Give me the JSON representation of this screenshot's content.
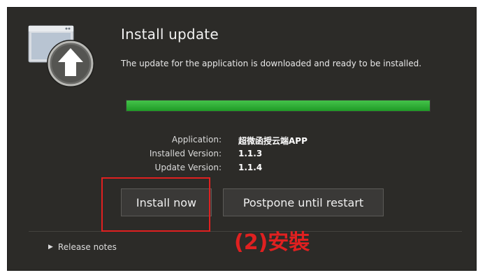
{
  "dialog": {
    "title": "Install update",
    "description": "The update for the application is downloaded and ready to be installed.",
    "progress": 1.0,
    "progress_color": "#2db334",
    "info": [
      {
        "label": "Application:",
        "value": "超微函授云端APP"
      },
      {
        "label": "Installed Version:",
        "value": "1.1.3"
      },
      {
        "label": "Update Version:",
        "value": "1.1.4"
      }
    ],
    "buttons": {
      "install": "Install now",
      "postpone": "Postpone until restart"
    },
    "release_notes": "Release notes",
    "icon": "upload-update-icon"
  },
  "annotation": {
    "text": "(2)安裝",
    "color": "#e02020"
  }
}
